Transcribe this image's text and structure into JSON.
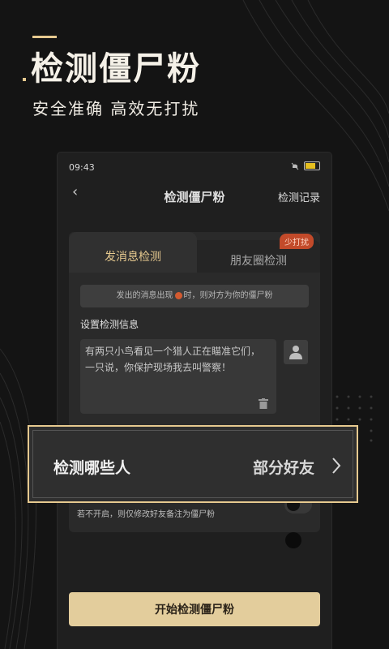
{
  "hero": {
    "title": "检测僵尸粉",
    "subtitle": "安全准确  高效无打扰"
  },
  "status_bar": {
    "time": "09:43"
  },
  "nav": {
    "title": "检测僵尸粉",
    "right_link": "检测记录"
  },
  "tabs": [
    {
      "label": "发消息检测",
      "active": true
    },
    {
      "label": "朋友圈检测",
      "active": false,
      "badge": "少打扰"
    }
  ],
  "notice": {
    "before": "发出的消息出现",
    "after": "时，则对方为你的僵尸粉"
  },
  "detect_info": {
    "section_title": "设置检测信息",
    "message": "有两只小鸟看见一个猎人正在瞄准它们，一只说，你保护现场我去叫警察！"
  },
  "hint": "若不开启，则仅修改好友备注为僵尸粉",
  "popup": {
    "label": "检测哪些人",
    "value": "部分好友"
  },
  "start_button": "开始检测僵尸粉",
  "colors": {
    "accent": "#e6c98f",
    "button_bg": "#e3cd9c",
    "badge_bg": "#c24a2a"
  }
}
